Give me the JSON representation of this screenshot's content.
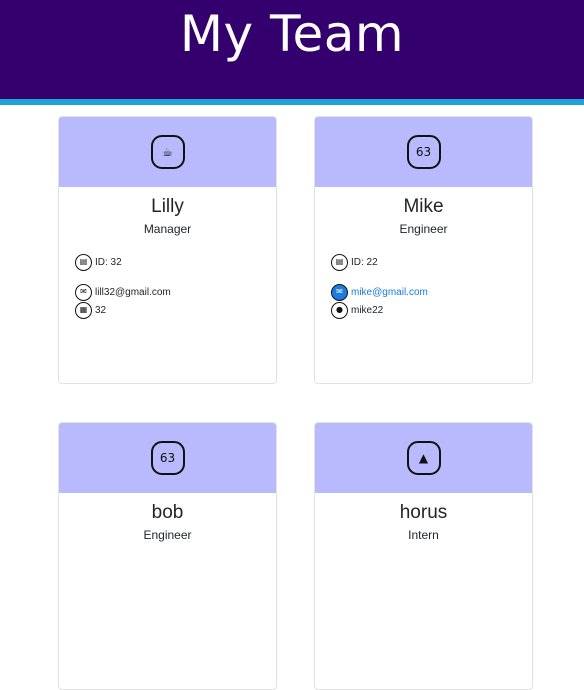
{
  "header": {
    "title": "My Team"
  },
  "cards": [
    {
      "name": "Lilly",
      "role": "Manager",
      "role_icon": "coffee-icon",
      "role_glyph": "☕",
      "id_text": "ID: 32",
      "email": "lill32@gmail.com",
      "extra_icon": "building-icon",
      "extra_glyph": "▦",
      "extra": "32"
    },
    {
      "name": "Mike",
      "role": "Engineer",
      "role_icon": "glasses-icon",
      "role_glyph": "63",
      "id_text": "ID: 22",
      "email": "mike@gmail.com",
      "extra_icon": "github-icon",
      "extra_glyph": "●",
      "extra": "mike22"
    },
    {
      "name": "bob",
      "role": "Engineer",
      "role_icon": "glasses-icon",
      "role_glyph": "63"
    },
    {
      "name": "horus",
      "role": "Intern",
      "role_icon": "graduate-icon",
      "role_glyph": "▲"
    }
  ]
}
